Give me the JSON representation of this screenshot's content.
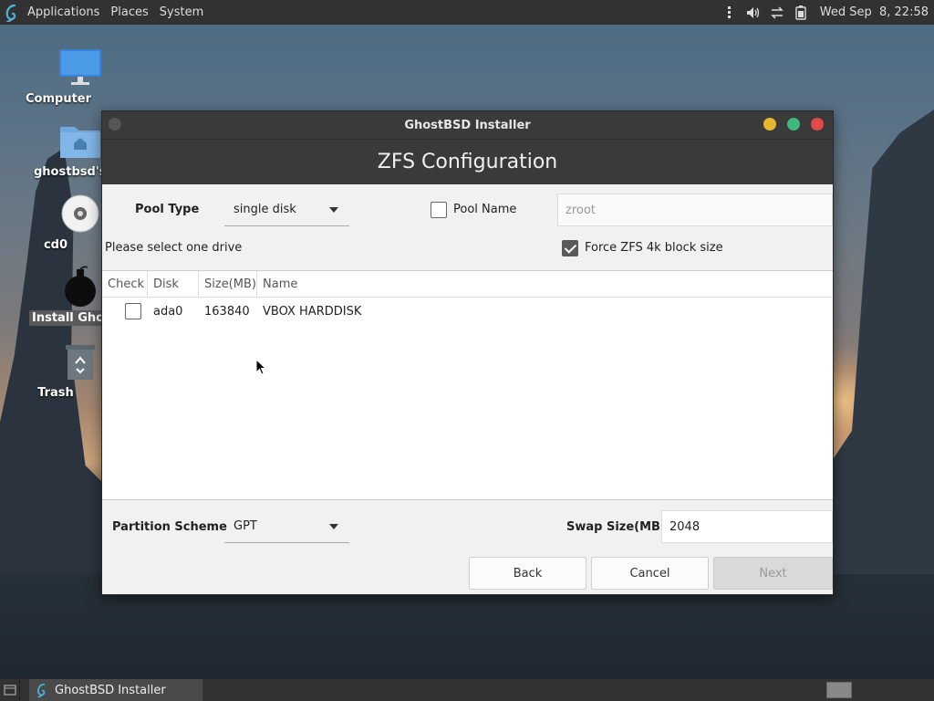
{
  "top_panel": {
    "menus": [
      "Applications",
      "Places",
      "System"
    ],
    "clock": "Wed Sep  8, 22:58",
    "tray_icons": [
      "volume-icon",
      "network-icon",
      "battery-icon"
    ]
  },
  "desktop": {
    "icons": [
      {
        "label": "Computer",
        "icon": "computer-icon"
      },
      {
        "label": "ghostbsd's H",
        "icon": "home-folder-icon"
      },
      {
        "label": "cd0",
        "icon": "disc-icon"
      },
      {
        "label": "Install Ghos",
        "icon": "installer-icon"
      },
      {
        "label": "Trash",
        "icon": "trash-icon"
      }
    ]
  },
  "window": {
    "title": "GhostBSD Installer",
    "heading": "ZFS Configuration",
    "pool_type_label": "Pool Type",
    "pool_type_value": "single disk",
    "pool_name_label": "Pool Name",
    "pool_name_checked": false,
    "pool_name_placeholder": "zroot",
    "select_drive_label": "Please select one drive",
    "force_4k_label": "Force ZFS 4k block size",
    "force_4k_checked": true,
    "table": {
      "columns": [
        "Check",
        "Disk",
        "Size(MB)",
        "Name"
      ],
      "rows": [
        {
          "checked": false,
          "disk": "ada0",
          "size": "163840",
          "name": "VBOX HARDDISK"
        }
      ]
    },
    "partition_scheme_label": "Partition Scheme",
    "partition_scheme_value": "GPT",
    "swap_size_label": "Swap Size(MB)",
    "swap_size_value": "2048",
    "buttons": {
      "back": "Back",
      "cancel": "Cancel",
      "next": "Next"
    }
  },
  "taskbar": {
    "task_label": "GhostBSD Installer"
  }
}
